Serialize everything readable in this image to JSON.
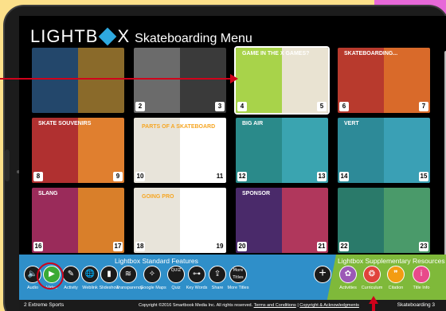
{
  "header": {
    "logo_left": "LIGHTB",
    "logo_right": "X",
    "title": "Skateboarding Menu"
  },
  "pages": [
    {
      "left": "",
      "right": "",
      "colors": [
        "#23476b",
        "#8a6a2a"
      ]
    },
    {
      "left": "2",
      "right": "3",
      "colors": [
        "#6b6b6b",
        "#3a3a3a"
      ]
    },
    {
      "left": "4",
      "right": "5",
      "colors": [
        "#a8d34a",
        "#e9e3d2"
      ],
      "title": "GAME IN THE X GAMES?"
    },
    {
      "left": "6",
      "right": "7",
      "colors": [
        "#b83a2d",
        "#d96a2a"
      ],
      "title": "SKATEBOARDING..."
    },
    {
      "left": "8",
      "right": "9",
      "colors": [
        "#b03030",
        "#e07f2f"
      ],
      "title": "SKATE SOUVENIRS"
    },
    {
      "left": "10",
      "right": "11",
      "colors": [
        "#e8e4da",
        "#ffffff"
      ],
      "title": "PARTS OF A SKATEBOARD"
    },
    {
      "left": "12",
      "right": "13",
      "colors": [
        "#2a8a8a",
        "#3aa4b0"
      ],
      "title": "BIG AIR"
    },
    {
      "left": "14",
      "right": "15",
      "colors": [
        "#2d8a98",
        "#3aa0b5"
      ],
      "title": "VERT"
    },
    {
      "left": "16",
      "right": "17",
      "colors": [
        "#9a2b5a",
        "#d97f2a"
      ],
      "title": "SLANG"
    },
    {
      "left": "18",
      "right": "19",
      "colors": [
        "#e8e4da",
        "#ffffff"
      ],
      "title": "GOING PRO"
    },
    {
      "left": "20",
      "right": "21",
      "colors": [
        "#4a2a6a",
        "#b0375c"
      ],
      "title": "SPONSOR"
    },
    {
      "left": "22",
      "right": "23",
      "colors": [
        "#2a7a6a",
        "#4a9a6a"
      ],
      "title": ""
    }
  ],
  "toolbar": {
    "std_title": "Lightbox Standard Features",
    "supp_title": "Lightbox Supplementary Resources",
    "std_tools": [
      {
        "label": "Audio",
        "icon": "speaker-icon",
        "glyph": "🔈"
      },
      {
        "label": "Video",
        "icon": "play-icon",
        "glyph": "▶"
      },
      {
        "label": "Activity",
        "icon": "pencil-icon",
        "glyph": "✎"
      },
      {
        "label": "Weblink",
        "icon": "globe-icon",
        "glyph": "🌐"
      },
      {
        "label": "Slideshow",
        "icon": "slides-icon",
        "glyph": "▮"
      },
      {
        "label": "Transparency",
        "icon": "layers-icon",
        "glyph": "≋"
      },
      {
        "label": "Google Maps",
        "icon": "map-icon",
        "glyph": "✧"
      },
      {
        "label": "Quiz",
        "icon": "quiz-icon",
        "glyph": "QUIZ"
      },
      {
        "label": "Key Words",
        "icon": "key-icon",
        "glyph": "⊶"
      },
      {
        "label": "Share",
        "icon": "share-icon",
        "glyph": "⇪"
      },
      {
        "label": "More Titles",
        "icon": "more-titles-icon",
        "glyph": "More Titles"
      }
    ],
    "supp_tools": [
      {
        "label": "Activities",
        "icon": "activities-icon",
        "glyph": "✿",
        "color": "#9b59b6"
      },
      {
        "label": "Curriculum",
        "icon": "curriculum-icon",
        "glyph": "❂",
        "color": "#e0433b"
      },
      {
        "label": "Citation",
        "icon": "citation-icon",
        "glyph": "❞",
        "color": "#f39c12"
      },
      {
        "label": "Title Info",
        "icon": "info-icon",
        "glyph": "i",
        "color": "#e84a8a"
      }
    ]
  },
  "footer": {
    "left": "2 Extreme Sports",
    "copyright": "Copyright ©2016 Smartbook Media Inc. All rights reserved.",
    "terms": "Terms and Conditions",
    "copyright_link": "Copyright & Acknowledgments",
    "right": "Skateboarding 3"
  }
}
